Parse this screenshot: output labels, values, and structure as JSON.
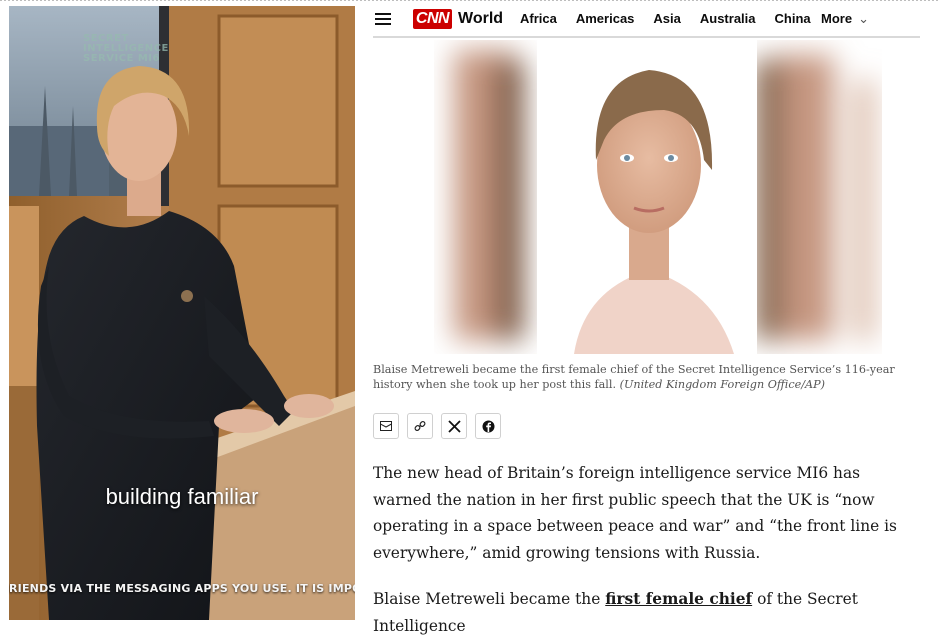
{
  "video": {
    "logo_lines": [
      "SECRET",
      "INTELLIGENCE",
      "SERVICE MI6"
    ],
    "subtitle": "building familiar",
    "ticker": "RIENDS VIA THE MESSAGING APPS YOU USE. IT IS IMPO"
  },
  "nav": {
    "logo": "CNN",
    "section": "World",
    "links": [
      "Africa",
      "Americas",
      "Asia",
      "Australia",
      "China"
    ],
    "more": "More"
  },
  "article": {
    "caption_text": "Blaise Metreweli became the first female chief of the Secret Intelligence Service’s 116-year history when she took up her post this fall.",
    "caption_credit": "(United Kingdom Foreign Office/AP)",
    "para1": "The new head of Britain’s foreign intelligence service MI6 has warned the nation in her first public speech that the UK is “now operating in a space between peace and war” and “the front line is everywhere,” amid growing tensions with Russia.",
    "para2_before": "Blaise Metreweli became the",
    "para2_link": "first female chief",
    "para2_after": "of the Secret Intelligence"
  },
  "share_icons": [
    "email-icon",
    "link-icon",
    "x-icon",
    "facebook-icon"
  ],
  "colors": {
    "cnn_red": "#cc0000",
    "text": "#1a1a1a",
    "caption": "#555555"
  }
}
